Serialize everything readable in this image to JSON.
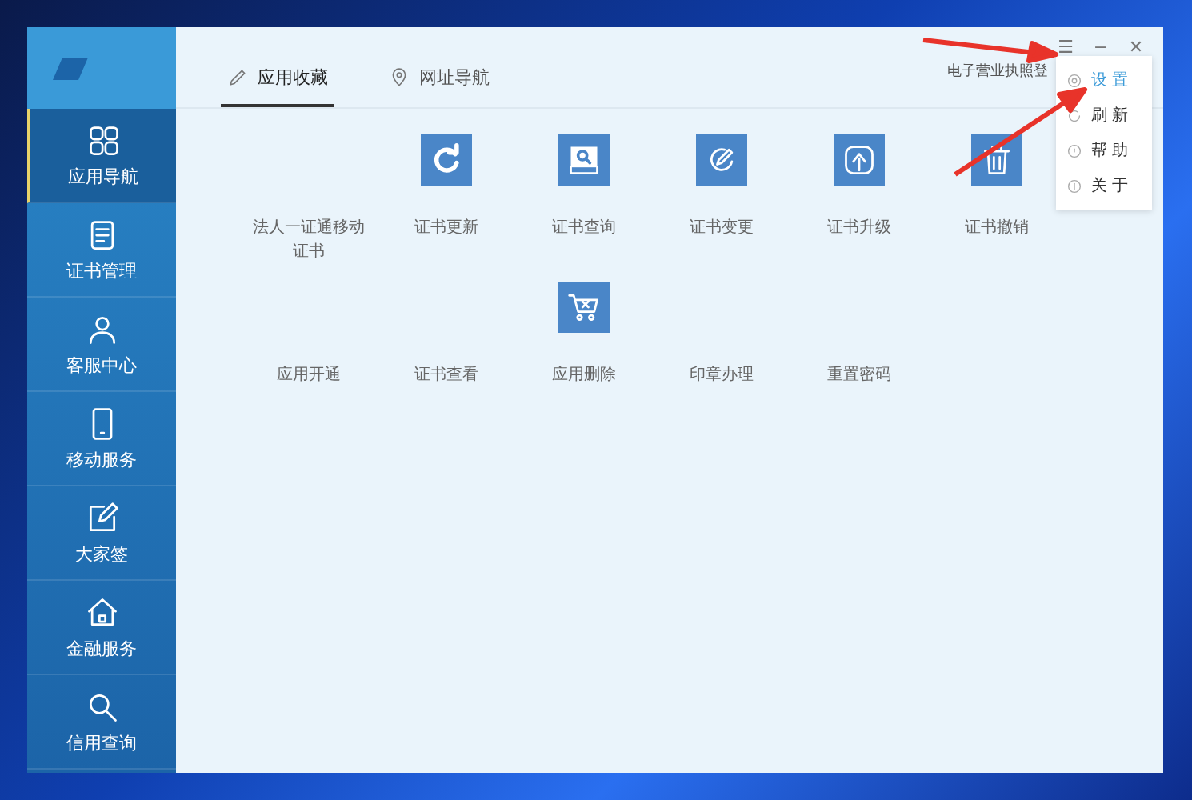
{
  "sidebar": {
    "items": [
      {
        "label": "应用导航",
        "selected": true
      },
      {
        "label": "证书管理",
        "selected": false
      },
      {
        "label": "客服中心",
        "selected": false
      },
      {
        "label": "移动服务",
        "selected": false
      },
      {
        "label": "大家签",
        "selected": false
      },
      {
        "label": "金融服务",
        "selected": false
      },
      {
        "label": "信用查询",
        "selected": false
      }
    ]
  },
  "tabs": [
    {
      "label": "应用收藏",
      "selected": true
    },
    {
      "label": "网址导航",
      "selected": false
    }
  ],
  "header_link": "电子营业执照登",
  "window_controls": [
    "☰",
    "−",
    "✕"
  ],
  "menu": {
    "items": [
      {
        "label": "设 置",
        "selected": true
      },
      {
        "label": "刷 新",
        "selected": false
      },
      {
        "label": "帮 助",
        "selected": false
      },
      {
        "label": "关 于",
        "selected": false
      }
    ]
  },
  "apps": [
    {
      "kind": "none",
      "label": "法人一证通移动证书"
    },
    {
      "kind": "refresh",
      "label": "证书更新"
    },
    {
      "kind": "search",
      "label": "证书查询"
    },
    {
      "kind": "edit",
      "label": "证书变更"
    },
    {
      "kind": "upgrade",
      "label": "证书升级"
    },
    {
      "kind": "trash",
      "label": "证书撤销"
    },
    {
      "kind": "none",
      "label": "应用开通"
    },
    {
      "kind": "none",
      "label": "证书查看"
    },
    {
      "kind": "cart",
      "label": "应用删除"
    },
    {
      "kind": "none",
      "label": "印章办理"
    },
    {
      "kind": "none",
      "label": "重置密码"
    }
  ]
}
